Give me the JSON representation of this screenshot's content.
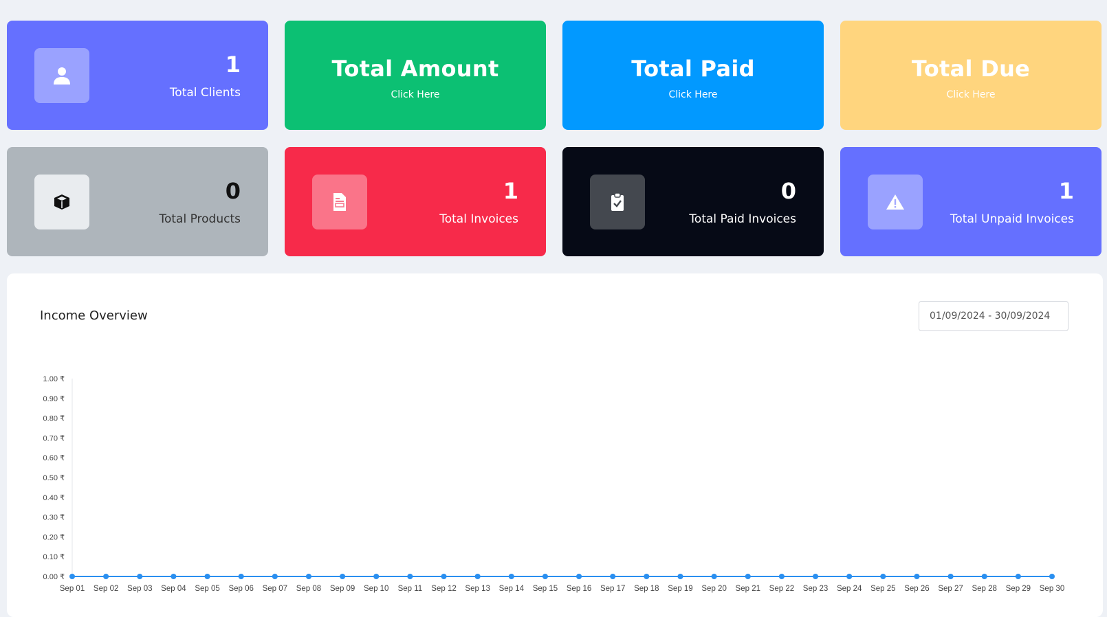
{
  "colors": {
    "page_bg": "#eef1f6",
    "indigo": "#6570ff",
    "green": "#0cc073",
    "blue": "#0299ff",
    "yellow": "#ffd57e",
    "gray": "#aeb5bb",
    "red": "#f72a4a",
    "black": "#060a16",
    "line": "#2a8ff0"
  },
  "stats_row1": {
    "clients": {
      "value": "1",
      "label": "Total Clients",
      "icon": "user-icon"
    },
    "amount": {
      "title": "Total Amount",
      "link": "Click Here"
    },
    "paid": {
      "title": "Total Paid",
      "link": "Click Here"
    },
    "due": {
      "title": "Total Due",
      "link": "Click Here"
    }
  },
  "stats_row2": {
    "products": {
      "value": "0",
      "label": "Total Products",
      "icon": "box-icon"
    },
    "invoices": {
      "value": "1",
      "label": "Total Invoices",
      "icon": "document-icon"
    },
    "paid_invoices": {
      "value": "0",
      "label": "Total Paid Invoices",
      "icon": "clipboard-check-icon"
    },
    "unpaid_invoices": {
      "value": "1",
      "label": "Total Unpaid Invoices",
      "icon": "warning-icon"
    }
  },
  "income_overview": {
    "title": "Income Overview",
    "date_range": "01/09/2024 - 30/09/2024"
  },
  "chart_data": {
    "type": "line",
    "title": "",
    "xlabel": "",
    "ylabel": "",
    "categories": [
      "Sep 01",
      "Sep 02",
      "Sep 03",
      "Sep 04",
      "Sep 05",
      "Sep 06",
      "Sep 07",
      "Sep 08",
      "Sep 09",
      "Sep 10",
      "Sep 11",
      "Sep 12",
      "Sep 13",
      "Sep 14",
      "Sep 15",
      "Sep 16",
      "Sep 17",
      "Sep 18",
      "Sep 19",
      "Sep 20",
      "Sep 21",
      "Sep 22",
      "Sep 23",
      "Sep 24",
      "Sep 25",
      "Sep 26",
      "Sep 27",
      "Sep 28",
      "Sep 29",
      "Sep 30"
    ],
    "values": [
      0,
      0,
      0,
      0,
      0,
      0,
      0,
      0,
      0,
      0,
      0,
      0,
      0,
      0,
      0,
      0,
      0,
      0,
      0,
      0,
      0,
      0,
      0,
      0,
      0,
      0,
      0,
      0,
      0,
      0
    ],
    "ylim": [
      0,
      1
    ],
    "yticks": [
      "0.00 ₹",
      "0.10 ₹",
      "0.20 ₹",
      "0.30 ₹",
      "0.40 ₹",
      "0.50 ₹",
      "0.60 ₹",
      "0.70 ₹",
      "0.80 ₹",
      "0.90 ₹",
      "1.00 ₹"
    ],
    "grid": false,
    "legend": "none"
  }
}
